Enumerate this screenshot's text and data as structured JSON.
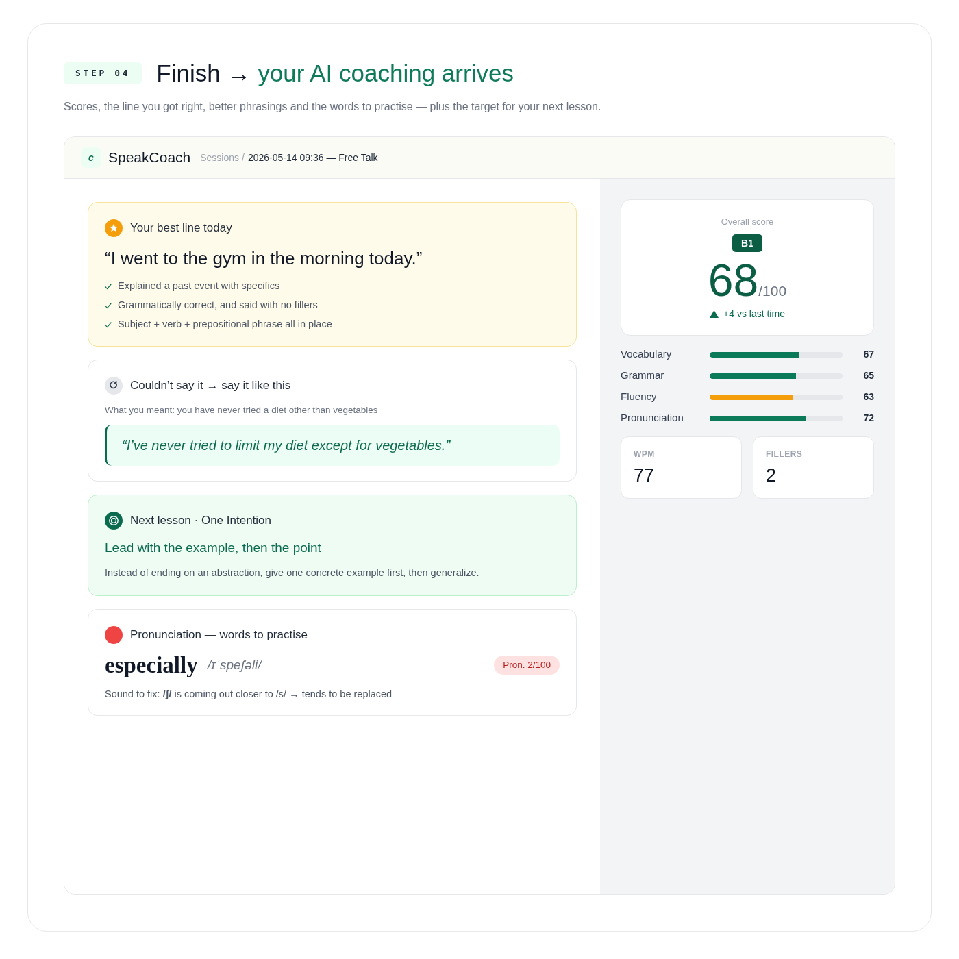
{
  "step": {
    "label": "STEP 04"
  },
  "heading": {
    "lead": "Finish →",
    "accent": "your AI coaching arrives"
  },
  "subtitle": "Scores, the line you got right, better phrasings and the words to practise — plus the target for your next lesson.",
  "app": {
    "logo": "c",
    "name": "SpeakCoach",
    "breadcrumb": {
      "parent": "Sessions",
      "separator": "/",
      "current": "2026-05-14 09:36 — Free Talk"
    }
  },
  "cards": [
    {
      "kind": "best_line",
      "title": "Your best line today",
      "quote": "“I went to the gym in the morning today.”",
      "points": [
        "Explained a past event with specifics",
        "Grammatically correct, and said with no fillers",
        "Subject + verb + prepositional phrase all in place"
      ]
    },
    {
      "kind": "rephrase",
      "title": "Couldn’t say it → say it like this",
      "meaning": "What you meant: you have never tried a diet other than vegetables",
      "suggestion": "“I’ve never tried to limit my diet except for vegetables.”"
    },
    {
      "kind": "next_lesson",
      "title": "Next lesson · One Intention",
      "goal": "Lead with the example, then the point",
      "detail": "Instead of ending on an abstraction, give one concrete example first, then generalize."
    },
    {
      "kind": "pronunciation",
      "title": "Pronunciation — words to practise",
      "word": "especially",
      "ipa": "/ɪˈspeʃəli/",
      "badge": "Pron. 2/100",
      "note": "Sound to fix: **/ʃ/** is coming out closer to /s/ → tends to be replaced"
    }
  ],
  "overall": {
    "label": "Overall score",
    "band": "B1",
    "score": "68",
    "out_of": "/100",
    "change": "+4 vs last time"
  },
  "metrics": [
    {
      "name": "Vocabulary",
      "level": 0.67,
      "value": "67",
      "color": "#0a7a58"
    },
    {
      "name": "Grammar",
      "level": 0.65,
      "value": "65",
      "color": "#0a7a58"
    },
    {
      "name": "Fluency",
      "level": 0.63,
      "value": "63",
      "color": "#f59e0b"
    },
    {
      "name": "Pronunciation",
      "level": 0.72,
      "value": "72",
      "color": "#0a7a58"
    }
  ],
  "stats": [
    {
      "label": "WPM",
      "value": "77"
    },
    {
      "label": "FILLERS",
      "value": "2"
    }
  ]
}
